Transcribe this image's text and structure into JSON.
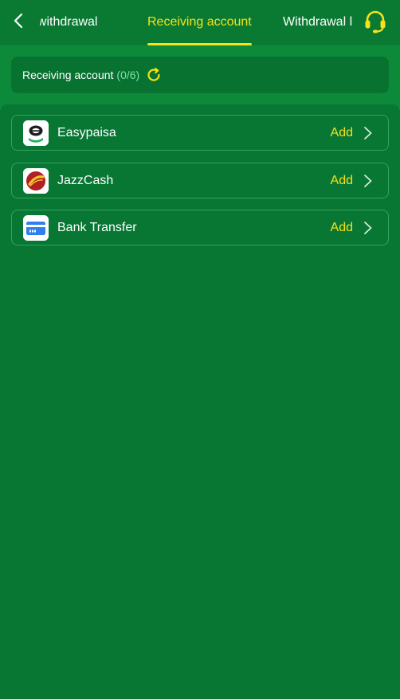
{
  "header": {
    "tabs": [
      {
        "label": "t withdrawal",
        "active": false
      },
      {
        "label": "Receiving account",
        "active": true
      },
      {
        "label": "Withdrawal l",
        "active": false
      }
    ],
    "icons": {
      "back": "chevron-left-icon",
      "support": "headset-icon"
    }
  },
  "summary": {
    "label": "Receiving account",
    "count": "(0/6)",
    "icon": "refresh-icon"
  },
  "methods": [
    {
      "name": "Easypaisa",
      "action": "Add",
      "logo": "easypaisa-logo"
    },
    {
      "name": "JazzCash",
      "action": "Add",
      "logo": "jazzcash-logo"
    },
    {
      "name": "Bank Transfer",
      "action": "Add",
      "logo": "bank-card-icon"
    }
  ],
  "colors": {
    "background": "#0a7a32",
    "accent": "#f7e11b",
    "count": "#7ee2a6"
  }
}
